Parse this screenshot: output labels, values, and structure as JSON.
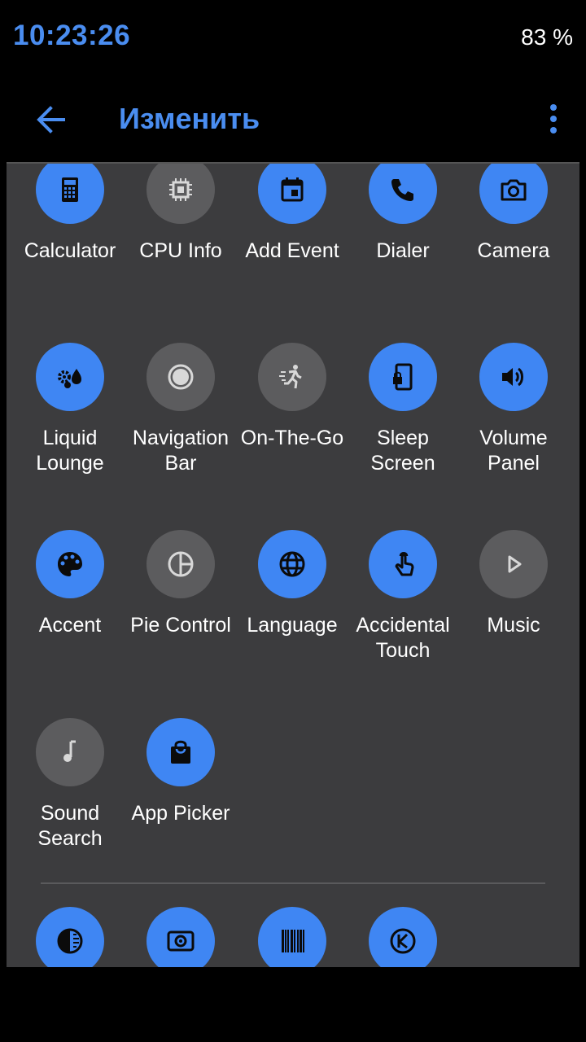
{
  "status": {
    "time": "10:23:26",
    "battery": "83 %"
  },
  "toolbar": {
    "title": "Изменить"
  },
  "colors": {
    "accent": "#4a8df0",
    "tile_on": "#3f86f3",
    "tile_off": "#5c5c5e",
    "panel_bg": "#3c3c3e"
  },
  "tiles": [
    {
      "label": "Calculator",
      "icon": "calculator-icon",
      "active": true
    },
    {
      "label": "CPU Info",
      "icon": "chip-icon",
      "active": false
    },
    {
      "label": "Add Event",
      "icon": "calendar-icon",
      "active": true
    },
    {
      "label": "Dialer",
      "icon": "phone-icon",
      "active": true
    },
    {
      "label": "Camera",
      "icon": "camera-icon",
      "active": true
    },
    {
      "label": "Liquid\nLounge",
      "icon": "gears-drop-icon",
      "active": true
    },
    {
      "label": "Navigation\nBar",
      "icon": "radio-circle-icon",
      "active": false
    },
    {
      "label": "On-The-Go",
      "icon": "running-person-icon",
      "active": false
    },
    {
      "label": "Sleep\nScreen",
      "icon": "phone-lock-icon",
      "active": true
    },
    {
      "label": "Volume\nPanel",
      "icon": "volume-icon",
      "active": true
    },
    {
      "label": "Accent",
      "icon": "palette-icon",
      "active": true
    },
    {
      "label": "Pie Control",
      "icon": "pie-icon",
      "active": false
    },
    {
      "label": "Language",
      "icon": "globe-icon",
      "active": true
    },
    {
      "label": "Accidental\nTouch",
      "icon": "touch-icon",
      "active": true
    },
    {
      "label": "Music",
      "icon": "play-icon",
      "active": false
    },
    {
      "label": "Sound\nSearch",
      "icon": "music-note-icon",
      "active": false
    },
    {
      "label": "App Picker",
      "icon": "shopping-bag-icon",
      "active": true
    }
  ],
  "available_tiles": [
    {
      "icon": "contrast-icon",
      "active": true
    },
    {
      "icon": "speaker-icon",
      "active": true
    },
    {
      "icon": "barcode-icon",
      "active": true
    },
    {
      "icon": "k-circle-icon",
      "active": true
    }
  ]
}
